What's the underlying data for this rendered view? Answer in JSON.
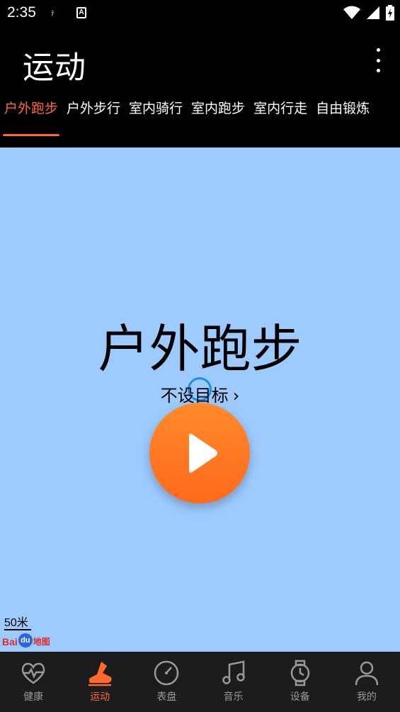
{
  "status": {
    "time": "2:35",
    "icon_s": "ﾃ",
    "icon_a": "A"
  },
  "app": {
    "title": "运动"
  },
  "tabs": [
    {
      "label": "户外跑步",
      "active": true
    },
    {
      "label": "户外步行"
    },
    {
      "label": "室内骑行"
    },
    {
      "label": "室内跑步"
    },
    {
      "label": "室内行走"
    },
    {
      "label": "自由锻炼"
    }
  ],
  "main": {
    "sport_name": "户外跑步",
    "goal": "不设目标",
    "goal_chevron": "›"
  },
  "map": {
    "scale": "50米",
    "logo_bai": "Bai",
    "logo_du": "du",
    "logo_ditu": "地图"
  },
  "nav": [
    {
      "label": "健康",
      "icon": "heart-pulse-icon"
    },
    {
      "label": "运动",
      "icon": "running-shoe-icon",
      "active": true
    },
    {
      "label": "表盘",
      "icon": "gauge-icon"
    },
    {
      "label": "音乐",
      "icon": "music-note-icon"
    },
    {
      "label": "设备",
      "icon": "watch-icon"
    },
    {
      "label": "我的",
      "icon": "person-icon"
    }
  ],
  "colors": {
    "accent": "#ff6a2a",
    "map_bg": "#9ecbff",
    "nav_bg": "#1c1c1e"
  }
}
